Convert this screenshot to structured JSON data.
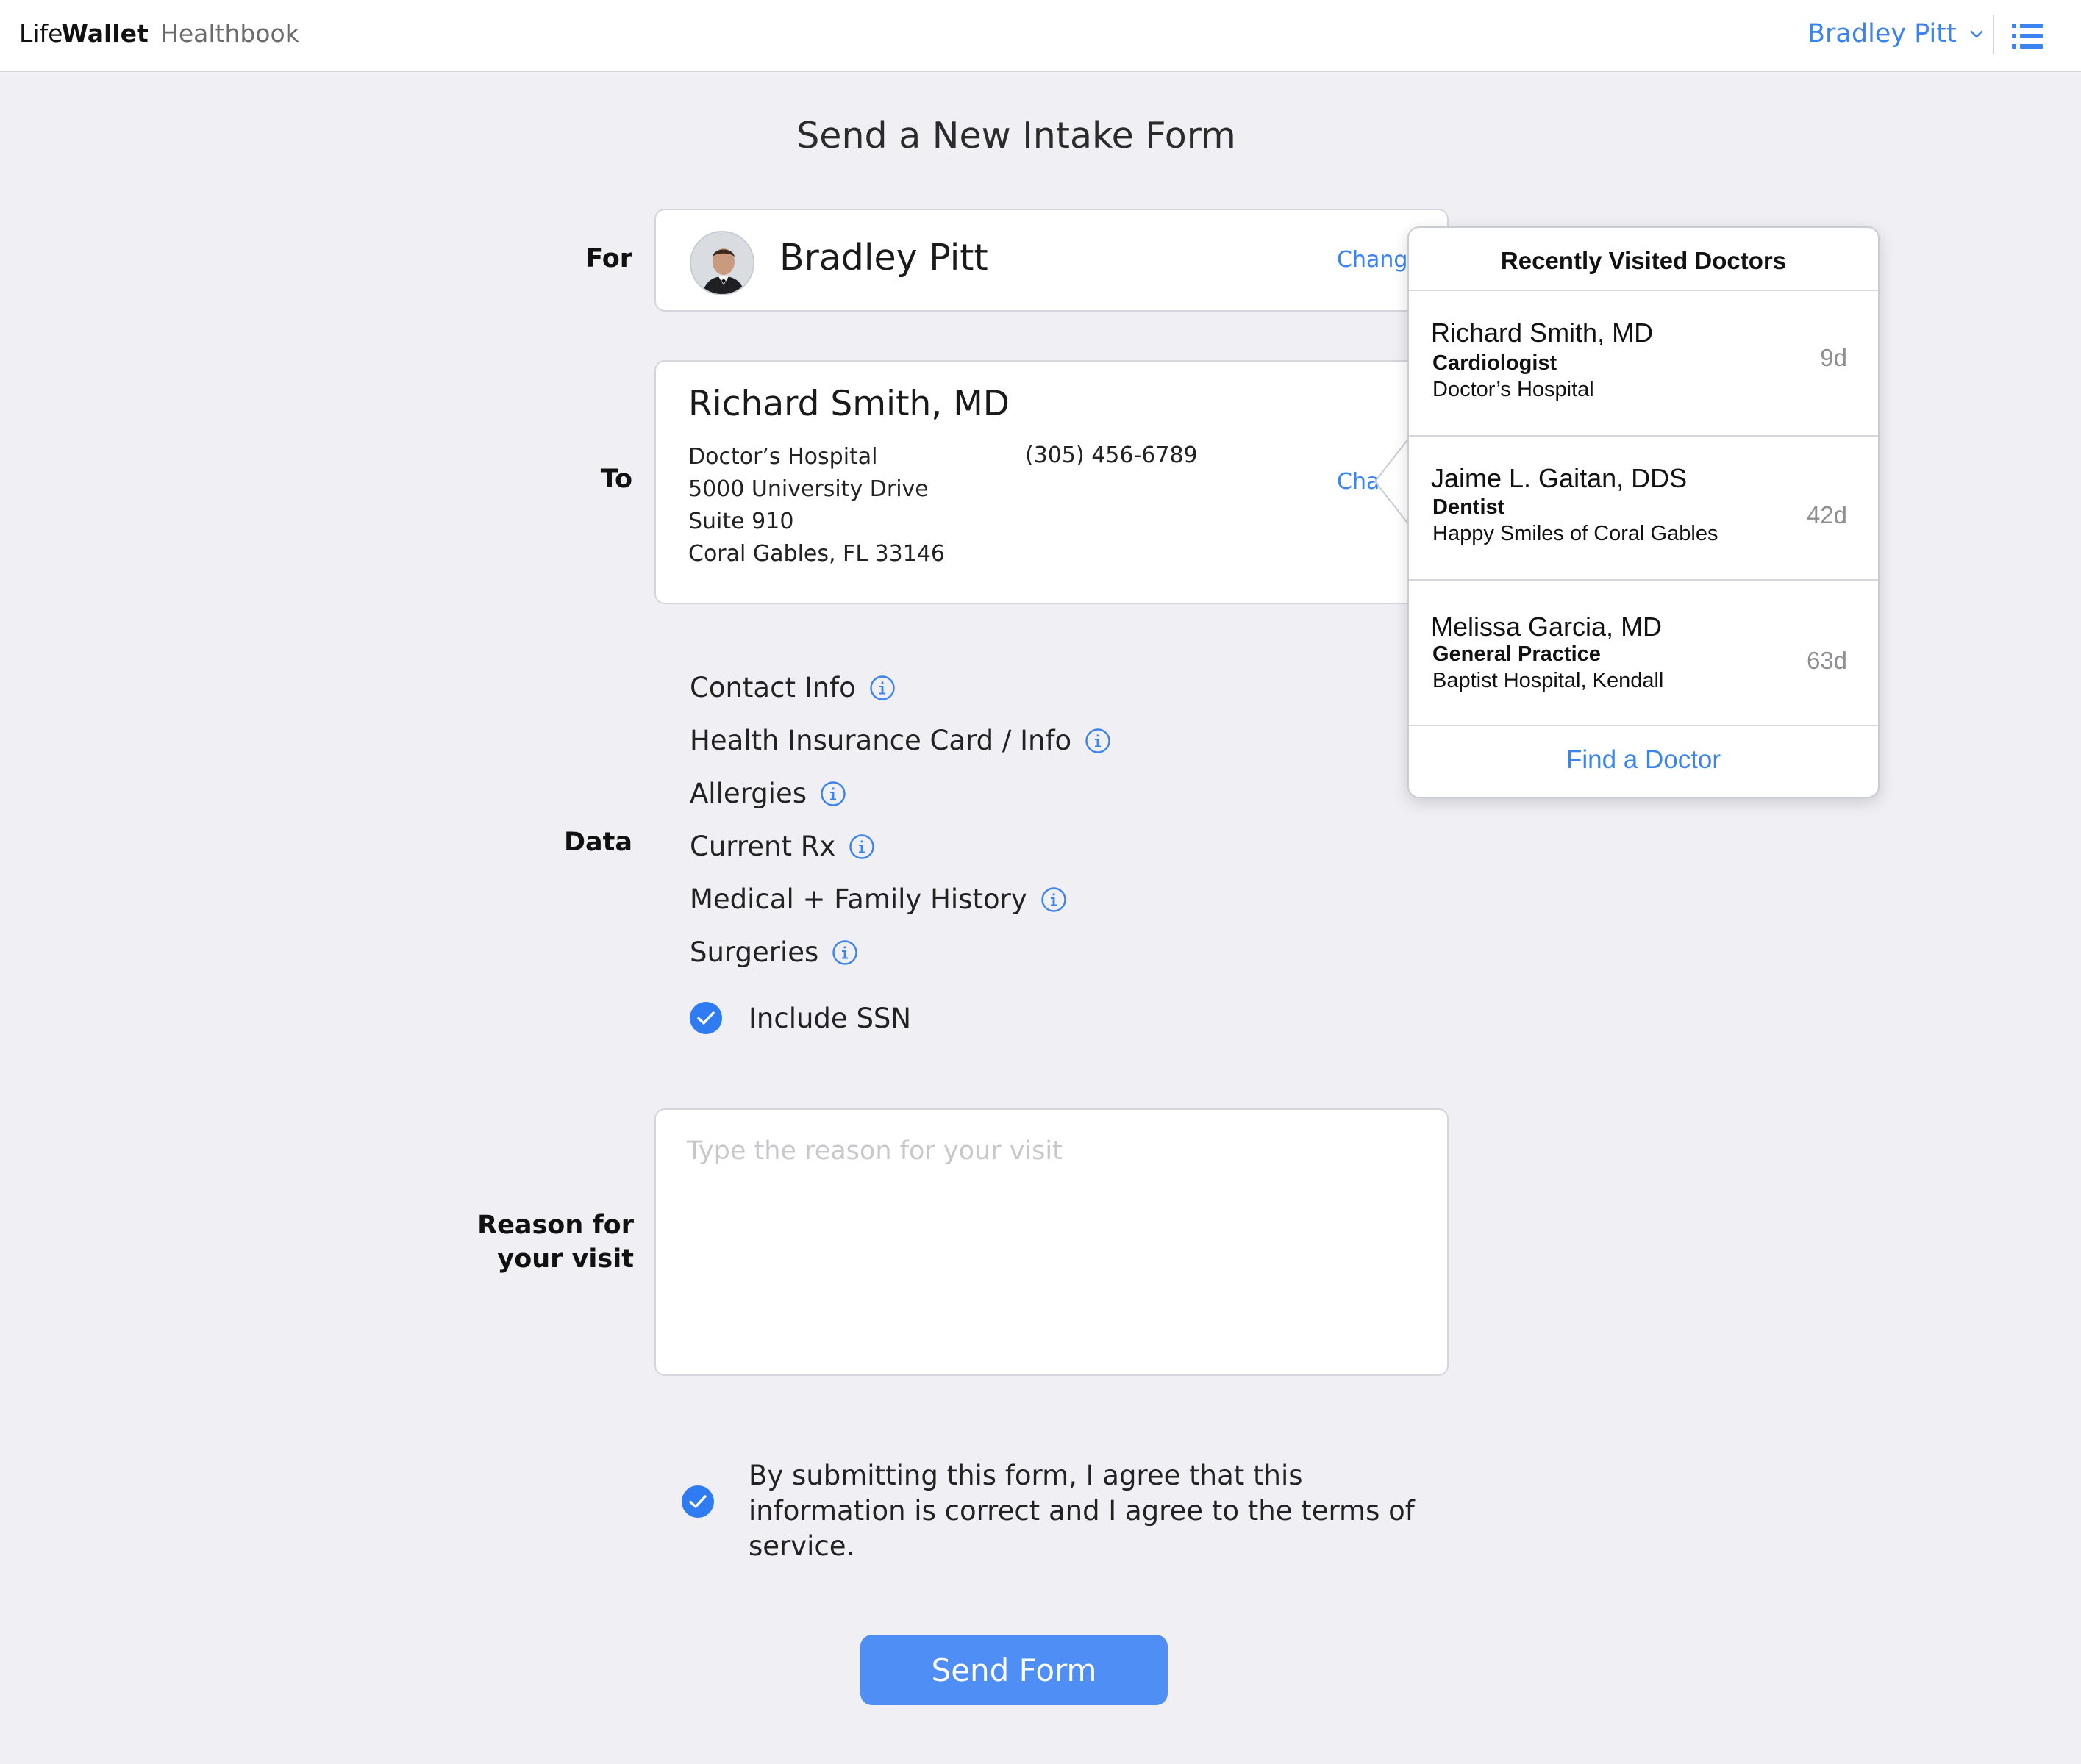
{
  "header": {
    "brand_life": "Life",
    "brand_wallet": "Wallet",
    "section": "Healthbook",
    "user_name": "Bradley Pitt",
    "menu_icon": "list-icon",
    "user_chevron_icon": "chevron-down-icon"
  },
  "page_title": "Send a New Intake Form",
  "labels": {
    "for": "For",
    "to": "To",
    "data": "Data",
    "reason_line1": "Reason for",
    "reason_line2": "your visit"
  },
  "for_card": {
    "patient_name": "Bradley Pitt",
    "change_label": "Change",
    "avatar_icon": "avatar"
  },
  "to_card": {
    "doctor_name": "Richard Smith, MD",
    "address_lines": [
      "Doctor’s Hospital",
      "5000 University Drive",
      "Suite 910",
      "Coral Gables, FL 33146"
    ],
    "phone": "(305) 456-6789",
    "change_label": "Change"
  },
  "data_items": [
    {
      "label": "Contact Info",
      "icon": "info-icon"
    },
    {
      "label": "Health Insurance Card / Info",
      "icon": "info-icon"
    },
    {
      "label": "Allergies",
      "icon": "info-icon"
    },
    {
      "label": "Current Rx",
      "icon": "info-icon"
    },
    {
      "label": "Medical + Family History",
      "icon": "info-icon"
    },
    {
      "label": "Surgeries",
      "icon": "info-icon"
    }
  ],
  "include_ssn": {
    "label": "Include SSN",
    "checked": true
  },
  "reason": {
    "placeholder": "Type the reason for your visit",
    "value": ""
  },
  "agreement": {
    "text": "By submitting this form, I agree that this information is correct and I agree to the terms of service.",
    "checked": true
  },
  "send_button": "Send Form",
  "popover": {
    "title": "Recently Visited Doctors",
    "doctors": [
      {
        "name": "Richard Smith, MD",
        "specialty": "Cardiologist",
        "place": "Doctor’s Hospital",
        "days": "9d"
      },
      {
        "name": "Jaime L. Gaitan, DDS",
        "specialty": "Dentist",
        "place": "Happy Smiles of Coral Gables",
        "days": "42d"
      },
      {
        "name": "Melissa Garcia, MD",
        "specialty": "General Practice",
        "place": "Baptist Hospital, Kendall",
        "days": "63d"
      }
    ],
    "find_label": "Find a Doctor"
  },
  "colors": {
    "accent": "#3a83f1",
    "button": "#4f8ef5",
    "background": "#efeff4",
    "border": "#d4d6dc"
  }
}
